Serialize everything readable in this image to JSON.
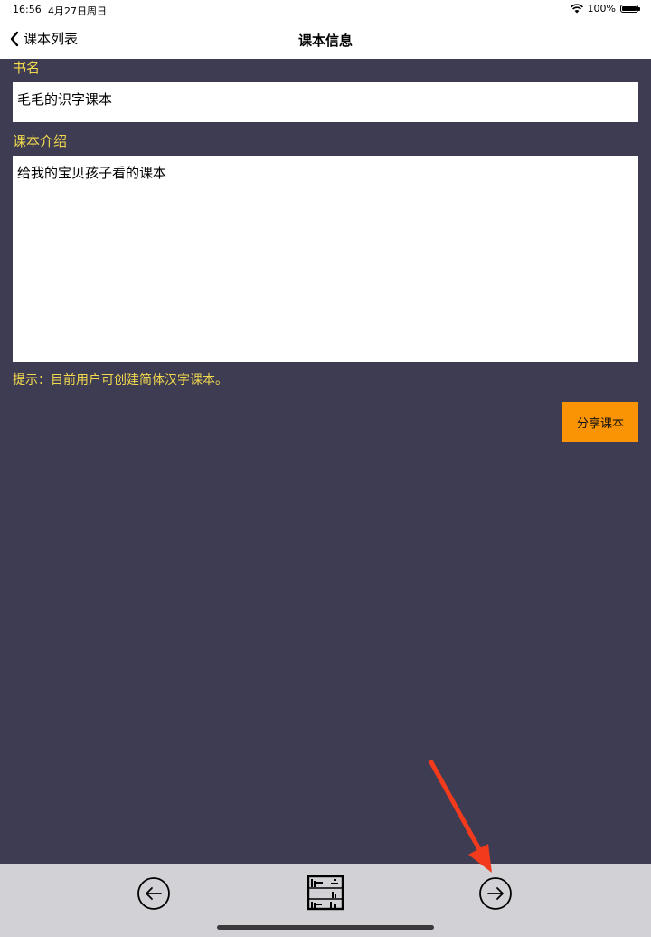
{
  "status_bar": {
    "time": "16:56",
    "date": "4月27日周日",
    "battery": "100%"
  },
  "nav": {
    "back_label": "课本列表",
    "title": "课本信息"
  },
  "form": {
    "book_name_label": "书名",
    "book_name_value": "毛毛的识字课本",
    "intro_label": "课本介绍",
    "intro_value": "给我的宝贝孩子看的课本",
    "hint": "提示：目前用户可创建简体汉字课本。"
  },
  "actions": {
    "share_label": "分享课本"
  },
  "toolbar": {
    "icons": [
      "arrow-left-circle-icon",
      "bookshelf-icon",
      "arrow-right-circle-icon"
    ]
  },
  "colors": {
    "background": "#3d3c52",
    "label": "#f2d94e",
    "share_button": "#fb9404",
    "toolbar": "#d1d1d6",
    "annotation_arrow": "#f23a1d"
  }
}
